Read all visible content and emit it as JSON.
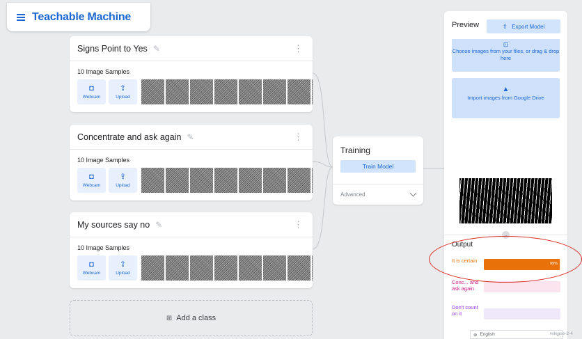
{
  "app": {
    "title": "Teachable Machine"
  },
  "classes": [
    {
      "name": "Signs Point to Yes",
      "samples": "10 Image Samples",
      "webcam": "Webcam",
      "upload": "Upload"
    },
    {
      "name": "Concentrate and ask again",
      "samples": "10 Image Samples",
      "webcam": "Webcam",
      "upload": "Upload"
    },
    {
      "name": "My sources say no",
      "samples": "10 Image Samples",
      "webcam": "Webcam",
      "upload": "Upload"
    }
  ],
  "add_class": {
    "label": "Add a class"
  },
  "training": {
    "title": "Training",
    "train_button": "Train Model",
    "advanced": "Advanced"
  },
  "preview": {
    "title": "Preview",
    "export_button": "Export Model",
    "drop_text": "Choose images from your files, or drag & drop here",
    "drive_text": "Import images from Google Drive",
    "output_label": "Output",
    "outputs": [
      {
        "label": "It is certain",
        "percent": 99,
        "percent_text": "99%",
        "color": "#e8710a",
        "track": "#fbe4d0",
        "text_color": "#e8710a"
      },
      {
        "label": "Conc... and ask again",
        "percent": 0,
        "percent_text": "",
        "color": "#d01884",
        "track": "#fce4ef",
        "text_color": "#d01884"
      },
      {
        "label": "Don't count on it",
        "percent": 0,
        "percent_text": "",
        "color": "#9334e6",
        "track": "#efe8fb",
        "text_color": "#9334e6"
      }
    ]
  },
  "footer": {
    "language": "English",
    "release": "release-2-4"
  },
  "icons": {
    "menu": "hamburger-icon",
    "edit": "pencil-icon",
    "more": "vertical-dots-icon",
    "webcam": "video-camera-icon",
    "upload": "upload-icon",
    "add": "plus-box-icon",
    "chevron": "chevron-down-icon",
    "export": "export-icon",
    "drive": "google-drive-icon",
    "globe": "globe-icon"
  }
}
